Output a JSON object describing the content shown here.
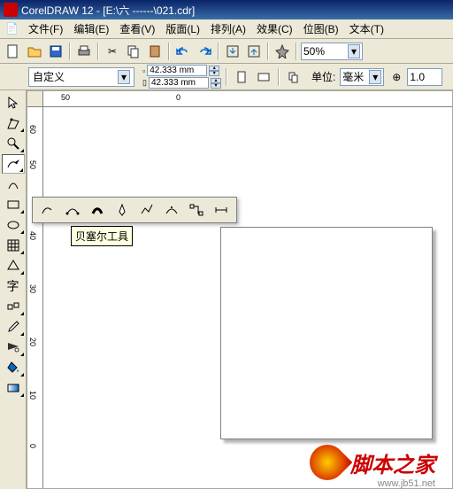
{
  "title": "CorelDRAW 12 - [E:\\六 ------\\021.cdr]",
  "menu": [
    "文件(F)",
    "编辑(E)",
    "查看(V)",
    "版面(L)",
    "排列(A)",
    "效果(C)",
    "位图(B)",
    "文本(T)"
  ],
  "zoom": "50%",
  "propbar": {
    "paper": "自定义",
    "width": "42.333 mm",
    "height": "42.333 mm",
    "unit_label": "单位:",
    "unit": "毫米",
    "nudge": "1.0"
  },
  "hruler_ticks": [
    {
      "label": "50",
      "pos": 20
    },
    {
      "label": "0",
      "pos": 150
    }
  ],
  "vruler_ticks": [
    {
      "label": "60",
      "pos": 20
    },
    {
      "label": "50",
      "pos": 60
    },
    {
      "label": "40",
      "pos": 140
    },
    {
      "label": "30",
      "pos": 200
    },
    {
      "label": "20",
      "pos": 260
    },
    {
      "label": "10",
      "pos": 320
    },
    {
      "label": "0",
      "pos": 380
    }
  ],
  "tooltip": "贝塞尔工具",
  "watermark": {
    "text": "脚本之家",
    "url": "www.jb51.net"
  }
}
